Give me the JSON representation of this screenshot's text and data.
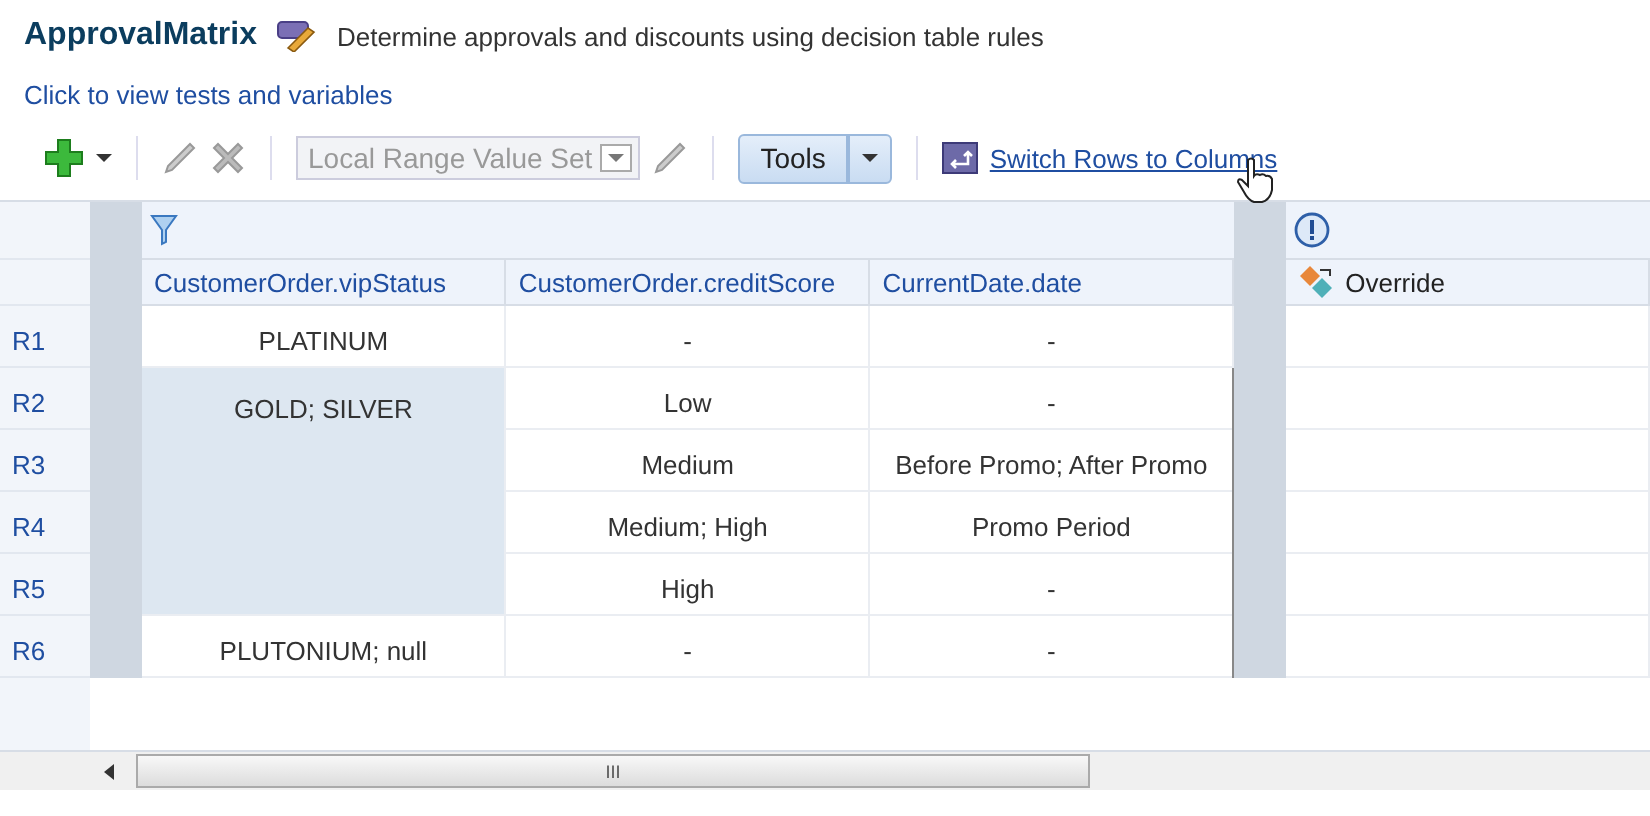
{
  "header": {
    "title": "ApprovalMatrix",
    "description": "Determine approvals and discounts using decision table rules"
  },
  "link": "Click to view tests and variables",
  "toolbar": {
    "value_set": {
      "label": "Local Range Value Set",
      "disabled": true
    },
    "tools": "Tools",
    "switch_link": "Switch Rows to Columns"
  },
  "table": {
    "columns": [
      "CustomerOrder.vipStatus",
      "CustomerOrder.creditScore",
      "CurrentDate.date"
    ],
    "action_column": "Override",
    "rows": [
      {
        "label": "R1",
        "vip_status": "PLATINUM",
        "merged": false,
        "selected": false,
        "credit_score": "-",
        "current_date": "-"
      },
      {
        "label": "R2",
        "vip_status": "GOLD; SILVER",
        "merged": false,
        "selected": true,
        "credit_score": "Low",
        "current_date": "-"
      },
      {
        "label": "R3",
        "merged": true,
        "credit_score": "Medium",
        "current_date": "Before Promo; After Promo"
      },
      {
        "label": "R4",
        "merged": true,
        "credit_score": "Medium; High",
        "current_date": "Promo Period"
      },
      {
        "label": "R5",
        "merged": true,
        "credit_score": "High",
        "current_date": "-"
      },
      {
        "label": "R6",
        "vip_status": "PLUTONIUM; null",
        "merged": false,
        "selected": false,
        "credit_score": "-",
        "current_date": "-"
      }
    ],
    "scrollbar_grip": "III"
  }
}
